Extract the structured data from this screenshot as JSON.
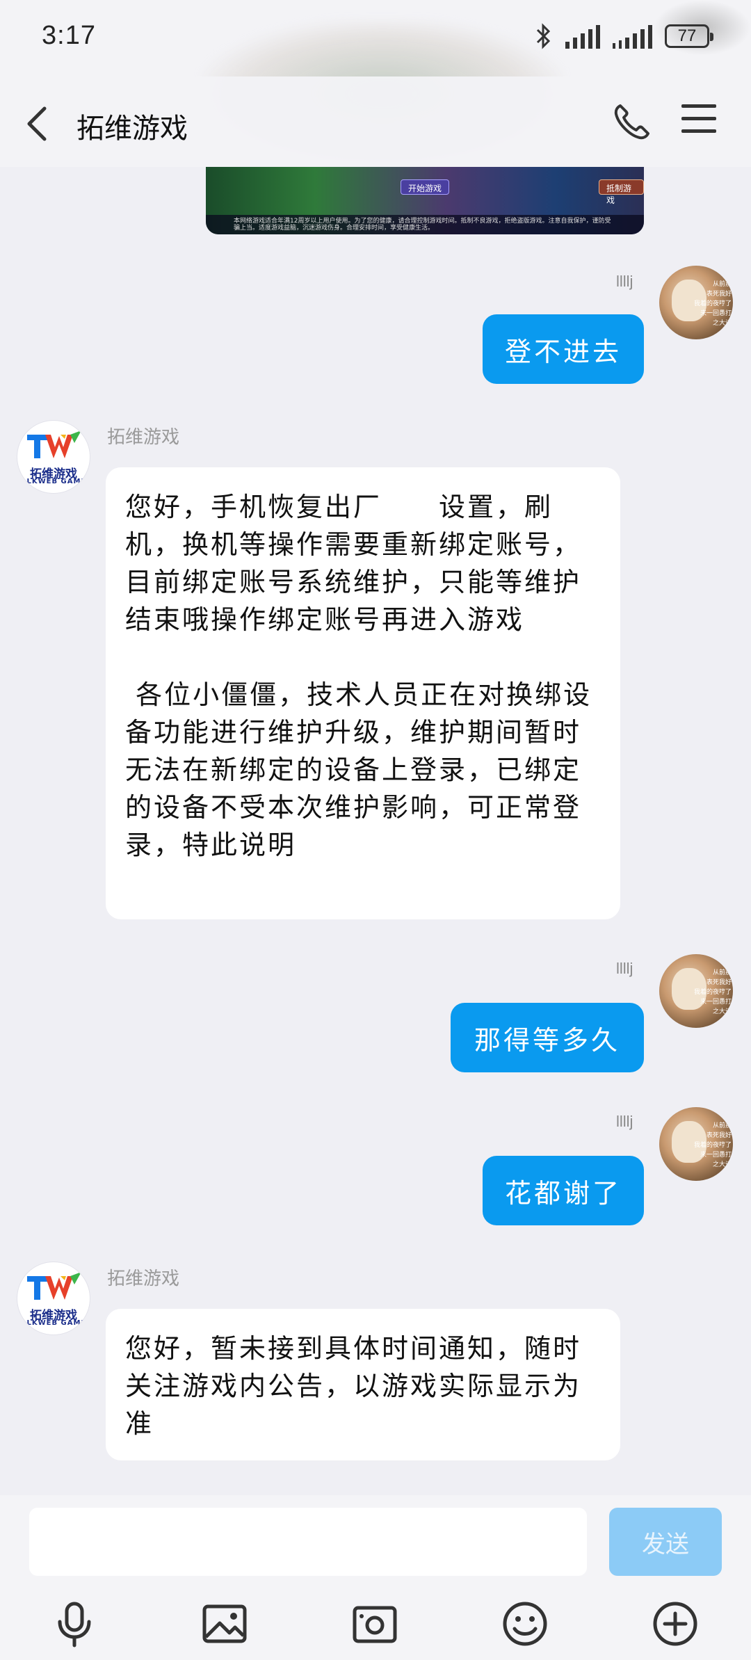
{
  "status_bar": {
    "time": "3:17",
    "battery": "77"
  },
  "header": {
    "title": "拓维游戏"
  },
  "banner": {
    "start_label": "开始游戏",
    "warn_label": "抵制游戏",
    "footer": "本网络游戏适合年满12周岁以上用户使用。为了您的健康，请合理控制游戏时间。抵制不良游戏，拒绝盗版游戏。注意自我保护，谨防受骗上当。适度游戏益脑，沉迷游戏伤身。合理安排时间，享受健康生活。"
  },
  "messages": [
    {
      "side": "out",
      "sender": "llllj",
      "text": "登不进去"
    },
    {
      "side": "in",
      "sender": "拓维游戏",
      "text": "您好，手机恢复出厂　　设置，刷机，换机等操作需要重新绑定账号，目前绑定账号系统维护，只能等维护结束哦操作绑定账号再进入游戏\n\n 各位小僵僵，技术人员正在对换绑设备功能进行维护升级，维护期间暂时无法在新绑定的设备上登录，已绑定的设备不受本次维护影响，可正常登录，特此说明"
    },
    {
      "side": "out",
      "sender": "llllj",
      "text": "那得等多久"
    },
    {
      "side": "out",
      "sender": "llllj",
      "text": "花都谢了"
    },
    {
      "side": "in",
      "sender": "拓维游戏",
      "text": "您好，暂未接到具体时间通知，随时关注游戏内公告，以游戏实际显示为准"
    }
  ],
  "avatar_tw": {
    "name": "拓维游戏",
    "sub": "ALKWEB GAME"
  },
  "input": {
    "value": "",
    "send_label": "发送"
  },
  "toolbar_icons": [
    "microphone-icon",
    "image-icon",
    "camera-icon",
    "emoji-icon",
    "plus-icon"
  ]
}
